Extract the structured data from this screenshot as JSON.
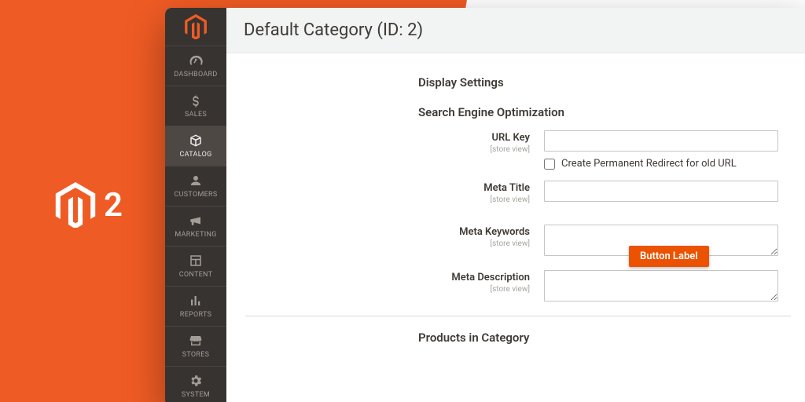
{
  "brand": {
    "two_label": "2"
  },
  "page": {
    "title": "Default Category (ID: 2)"
  },
  "sidebar": {
    "items": [
      {
        "label": "DASHBOARD"
      },
      {
        "label": "SALES"
      },
      {
        "label": "CATALOG"
      },
      {
        "label": "CUSTOMERS"
      },
      {
        "label": "MARKETING"
      },
      {
        "label": "CONTENT"
      },
      {
        "label": "REPORTS"
      },
      {
        "label": "STORES"
      },
      {
        "label": "SYSTEM"
      }
    ]
  },
  "sections": {
    "display_settings": "Display Settings",
    "seo": "Search Engine Optimization",
    "products": "Products in Category"
  },
  "form": {
    "scope_text": "[store view]",
    "url_key": {
      "label": "URL Key",
      "value": "",
      "redirect_label": "Create Permanent Redirect for old URL"
    },
    "meta_title": {
      "label": "Meta Title",
      "value": ""
    },
    "meta_keywords": {
      "label": "Meta Keywords",
      "value": ""
    },
    "meta_description": {
      "label": "Meta Description",
      "value": ""
    }
  },
  "button": {
    "label": "Button Label"
  }
}
